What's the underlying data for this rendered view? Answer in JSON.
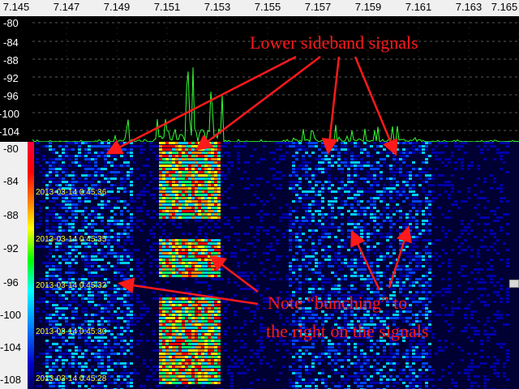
{
  "frequency_axis": {
    "labels": [
      "7.145",
      "7.147",
      "7.149",
      "7.151",
      "7.153",
      "7.155",
      "7.157",
      "7.159",
      "7.161",
      "7.163",
      "7.165"
    ]
  },
  "spectrum": {
    "db_labels": [
      "-80",
      "-84",
      "-88",
      "-92",
      "-96",
      "-100",
      "-104"
    ]
  },
  "waterfall": {
    "scale_labels": [
      "-80",
      "-84",
      "-88",
      "-92",
      "-96",
      "-100",
      "-104",
      "-108"
    ],
    "timestamps": [
      "2013-03-14 0:45:36",
      "2013-03-14 0:45:35",
      "2013-03-14 0:45:32",
      "2013-03-14 0:45:30",
      "2013-03-14 0:45:28"
    ]
  },
  "annotations": {
    "lower_sideband": "Lower sideband signals",
    "bunching_line1": "Note “bunching” to",
    "bunching_line2": "the right on the signals"
  },
  "colors": {
    "annotation": "#ff1a1a",
    "spectrum_trace": "#33ff33",
    "spectrum_bg": "#000000",
    "waterfall_bg": "#000033"
  }
}
